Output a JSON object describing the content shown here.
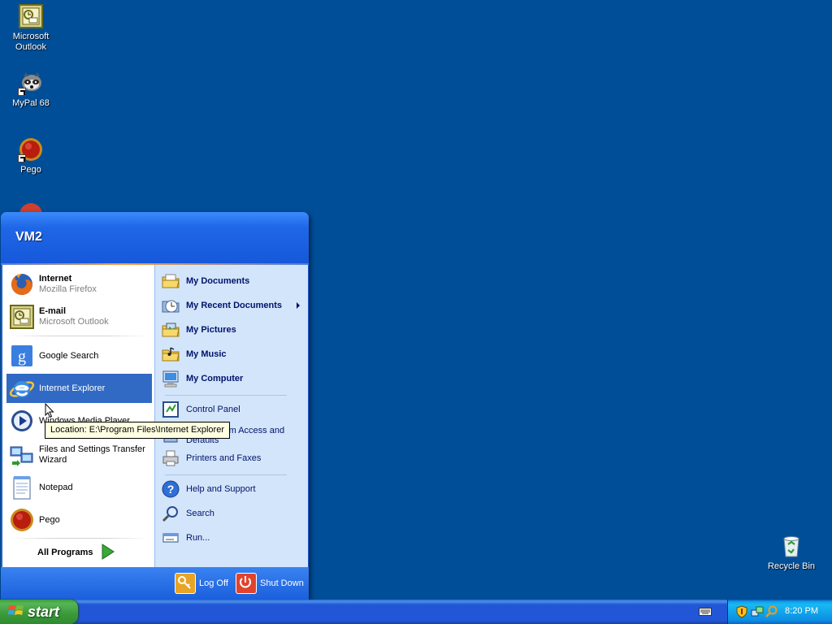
{
  "desktop": {
    "icons": [
      {
        "label_1": "Microsoft",
        "label_2": "Outlook",
        "icon": "outlook-icon"
      },
      {
        "label_1": "MyPal 68",
        "label_2": "",
        "icon": "mypal-icon"
      },
      {
        "label_1": "Pego",
        "label_2": "",
        "icon": "pego-icon"
      },
      {
        "label_1": "Recycle Bin",
        "label_2": "",
        "icon": "recycle-bin-icon"
      }
    ]
  },
  "start_menu": {
    "user": "VM2",
    "pinned": [
      {
        "title": "Internet",
        "subtitle": "Mozilla Firefox",
        "icon": "firefox-icon"
      },
      {
        "title": "E-mail",
        "subtitle": "Microsoft Outlook",
        "icon": "outlook-icon"
      }
    ],
    "recent": [
      {
        "title": "Google Search",
        "icon": "google-icon"
      },
      {
        "title": "Internet Explorer",
        "icon": "internet-explorer-icon",
        "highlighted": true
      },
      {
        "title": "Windows Media Player",
        "icon": "media-player-icon"
      },
      {
        "title_1": "Files and Settings Transfer",
        "title_2": "Wizard",
        "icon": "transfer-wizard-icon"
      },
      {
        "title": "Notepad",
        "icon": "notepad-icon"
      },
      {
        "title": "Pego",
        "icon": "pego-icon"
      }
    ],
    "all_programs": "All Programs",
    "places": [
      {
        "title": "My Documents",
        "icon": "my-documents-icon"
      },
      {
        "title": "My Recent Documents",
        "icon": "recent-documents-icon"
      },
      {
        "title": "My Pictures",
        "icon": "my-pictures-icon"
      },
      {
        "title": "My Music",
        "icon": "my-music-icon"
      },
      {
        "title": "My Computer",
        "icon": "my-computer-icon"
      }
    ],
    "system": [
      {
        "title": "Control Panel",
        "icon": "control-panel-icon"
      },
      {
        "title_1": "Set Program Access and",
        "title_2": "Defaults",
        "icon": "program-access-icon"
      },
      {
        "title": "Printers and Faxes",
        "icon": "printer-icon"
      }
    ],
    "support": [
      {
        "title": "Help and Support",
        "icon": "help-icon"
      },
      {
        "title": "Search",
        "icon": "search-icon"
      },
      {
        "title": "Run...",
        "icon": "run-icon"
      }
    ],
    "footer": {
      "log_off": "Log Off",
      "shut_down": "Shut Down"
    }
  },
  "tooltip": "Location: E:\\Program Files\\Internet Explorer",
  "taskbar": {
    "start_label": "start",
    "clock": "8:20 PM"
  },
  "colors": {
    "desktop": "#004e98",
    "highlight": "#316ac5",
    "menu_header": "#1f67e6",
    "right_pane": "#d3e5fa"
  }
}
